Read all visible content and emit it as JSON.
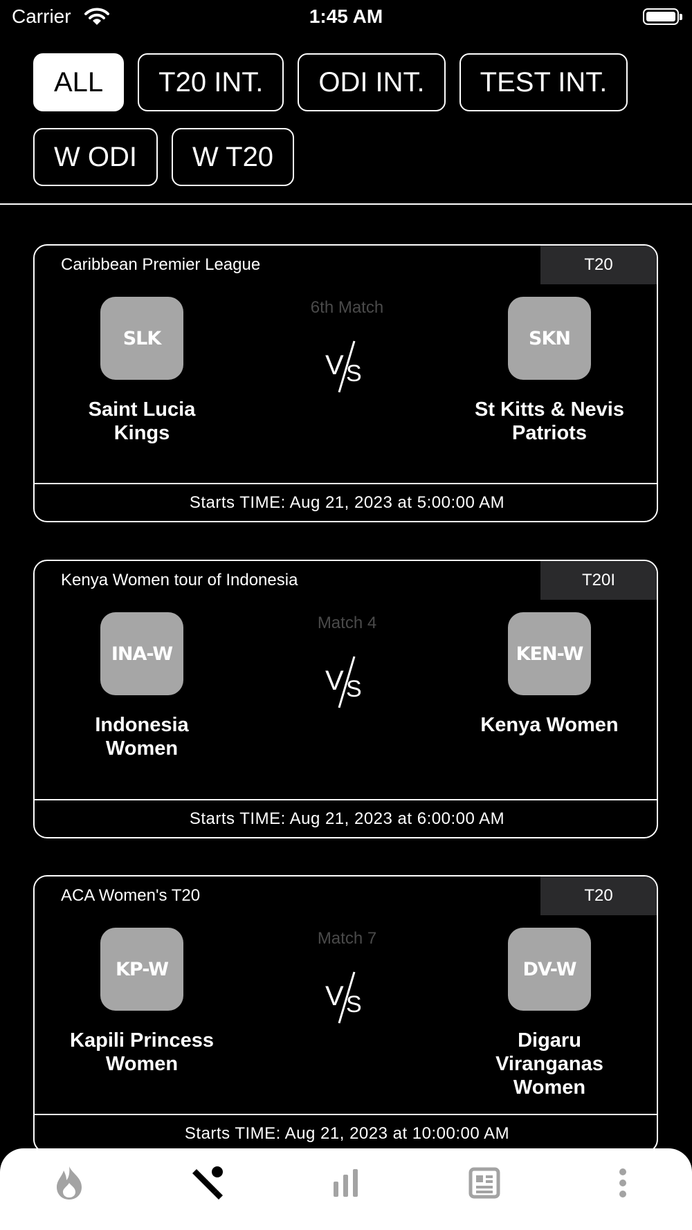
{
  "status_bar": {
    "carrier": "Carrier",
    "time": "1:45 AM"
  },
  "filters": [
    {
      "label": "ALL",
      "active": true
    },
    {
      "label": "T20 INT.",
      "active": false
    },
    {
      "label": "ODI INT.",
      "active": false
    },
    {
      "label": "TEST INT.",
      "active": false
    },
    {
      "label": "W ODI",
      "active": false
    },
    {
      "label": "W T20",
      "active": false
    }
  ],
  "matches": [
    {
      "series": "Caribbean Premier League",
      "format": "T20",
      "match_no": "6th Match",
      "team1": {
        "code": "SLK",
        "name": "Saint Lucia Kings"
      },
      "team2": {
        "code": "SKN",
        "name": "St Kitts & Nevis Patriots"
      },
      "start": "Starts TIME: Aug 21, 2023 at 5:00:00 AM"
    },
    {
      "series": "Kenya Women tour of Indonesia",
      "format": "T20I",
      "match_no": "Match 4",
      "team1": {
        "code": "INA-W",
        "name": "Indonesia Women"
      },
      "team2": {
        "code": "KEN-W",
        "name": "Kenya Women"
      },
      "start": "Starts TIME: Aug 21, 2023 at 6:00:00 AM"
    },
    {
      "series": "ACA Women's T20",
      "format": "T20",
      "match_no": "Match 7",
      "team1": {
        "code": "KP-W",
        "name": "Kapili Princess Women"
      },
      "team2": {
        "code": "DV-W",
        "name": "Digaru Viranganas Women"
      },
      "start": "Starts TIME: Aug 21, 2023 at 10:00:00 AM"
    }
  ],
  "tabs": [
    {
      "icon": "flame-icon",
      "active": false
    },
    {
      "icon": "cricket-bat-icon",
      "active": true
    },
    {
      "icon": "bar-chart-icon",
      "active": false
    },
    {
      "icon": "news-icon",
      "active": false
    },
    {
      "icon": "more-vertical-icon",
      "active": false
    }
  ],
  "colors": {
    "background": "#000000",
    "logo_bg": "#a6a6a6",
    "format_bg": "#2a2a2c",
    "tab_inactive": "#a3a3a3",
    "tab_active": "#000000"
  }
}
